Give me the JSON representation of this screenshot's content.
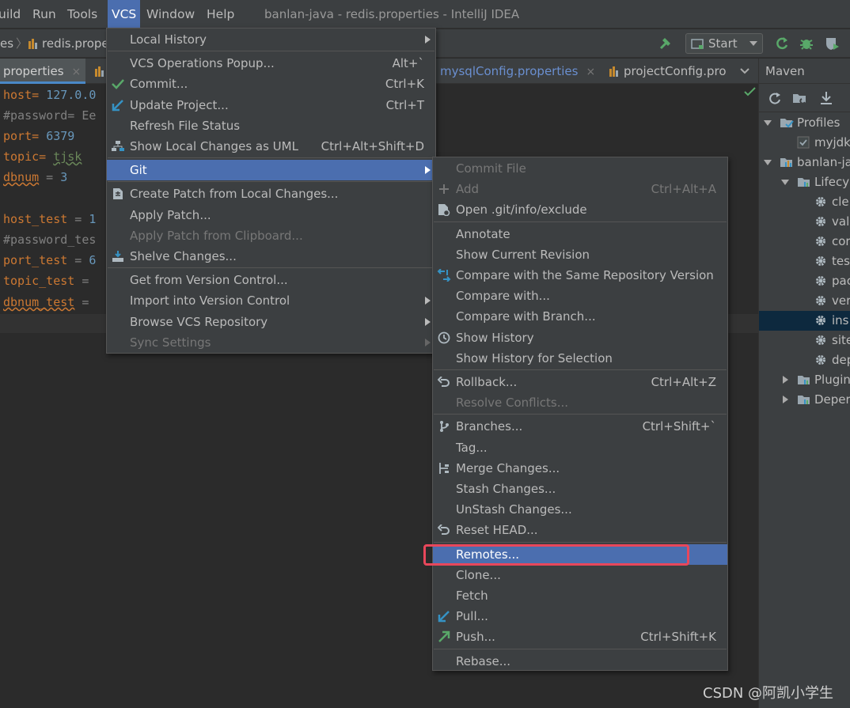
{
  "window": {
    "title": "banlan-java - redis.properties - IntelliJ IDEA"
  },
  "menubar": {
    "items": [
      {
        "label": "uild",
        "name": "menu-build",
        "active": false
      },
      {
        "label": "Run",
        "name": "menu-run",
        "active": false
      },
      {
        "label": "Tools",
        "name": "menu-tools",
        "active": false
      },
      {
        "label": "VCS",
        "name": "menu-vcs",
        "active": true
      },
      {
        "label": "Window",
        "name": "menu-window",
        "active": false
      },
      {
        "label": "Help",
        "name": "menu-help",
        "active": false
      }
    ]
  },
  "navbar": {
    "crumb_prev": "es",
    "crumb_file": "redis.prope",
    "run_config": "Start"
  },
  "tabs": [
    {
      "label": "properties",
      "close": "×"
    },
    {
      "label": "mysqlConfig.properties",
      "close": "×"
    },
    {
      "label": "projectConfig.pro",
      "close": ""
    }
  ],
  "editor": {
    "lines": [
      {
        "key": "host",
        "sep": "= ",
        "value": "127.0.0",
        "kind": "num"
      },
      {
        "key": "#password= Ee",
        "sep": "",
        "value": "",
        "kind": "comment"
      },
      {
        "key": "port",
        "sep": "= ",
        "value": "6379",
        "kind": "num"
      },
      {
        "key": "topic",
        "sep": "= ",
        "value": "tjsk",
        "kind": "str"
      },
      {
        "key": "dbnum",
        "sep": " = ",
        "value": "3",
        "kind": "num"
      },
      {
        "key": "",
        "sep": "",
        "value": "",
        "kind": "blank"
      },
      {
        "key": "host_test",
        "sep": " = ",
        "value": "1",
        "kind": "num"
      },
      {
        "key": "#password_tes",
        "sep": "",
        "value": "",
        "kind": "comment"
      },
      {
        "key": "port_test",
        "sep": " = ",
        "value": "6",
        "kind": "num"
      },
      {
        "key": "topic_test",
        "sep": " =",
        "value": "",
        "kind": "num"
      },
      {
        "key": "dbnum_test",
        "sep": " =",
        "value": "",
        "kind": "num"
      }
    ]
  },
  "maven": {
    "title": "Maven",
    "tree": [
      {
        "label": "Profiles",
        "icon": "profiles-icon",
        "expander": "down",
        "level": 0
      },
      {
        "label": "myjdk",
        "icon": "checkbox-icon",
        "expander": "",
        "level": 1
      },
      {
        "label": "banlan-ja",
        "icon": "maven-project-icon",
        "expander": "down",
        "level": 0
      },
      {
        "label": "Lifecyc",
        "icon": "folder-icon",
        "expander": "down",
        "level": 1
      },
      {
        "label": "cle",
        "icon": "gear-icon",
        "expander": "",
        "level": 2
      },
      {
        "label": "val",
        "icon": "gear-icon",
        "expander": "",
        "level": 2
      },
      {
        "label": "cor",
        "icon": "gear-icon",
        "expander": "",
        "level": 2
      },
      {
        "label": "tes",
        "icon": "gear-icon",
        "expander": "",
        "level": 2
      },
      {
        "label": "pac",
        "icon": "gear-icon",
        "expander": "",
        "level": 2
      },
      {
        "label": "ver",
        "icon": "gear-icon",
        "expander": "",
        "level": 2
      },
      {
        "label": "ins",
        "icon": "gear-icon",
        "expander": "",
        "level": 2,
        "selected": true
      },
      {
        "label": "site",
        "icon": "gear-icon",
        "expander": "",
        "level": 2
      },
      {
        "label": "dep",
        "icon": "gear-icon",
        "expander": "",
        "level": 2
      },
      {
        "label": "Plugin",
        "icon": "folder-icon",
        "expander": "right",
        "level": 1
      },
      {
        "label": "Deper",
        "icon": "folder-icon",
        "expander": "right",
        "level": 1
      }
    ]
  },
  "vcs_menu": {
    "items": [
      {
        "label": "Local History",
        "shortcut": "",
        "submenu": true,
        "icon": "",
        "state": "normal",
        "sep_after": true
      },
      {
        "label": "VCS Operations Popup...",
        "shortcut": "Alt+`",
        "submenu": false,
        "icon": "",
        "state": "normal"
      },
      {
        "label": "Commit...",
        "shortcut": "Ctrl+K",
        "submenu": false,
        "icon": "check-icon",
        "state": "normal"
      },
      {
        "label": "Update Project...",
        "shortcut": "Ctrl+T",
        "submenu": false,
        "icon": "update-arrow-icon",
        "state": "normal"
      },
      {
        "label": "Refresh File Status",
        "shortcut": "",
        "submenu": false,
        "icon": "",
        "state": "normal"
      },
      {
        "label": "Show Local Changes as UML",
        "shortcut": "Ctrl+Alt+Shift+D",
        "submenu": false,
        "icon": "uml-icon",
        "state": "normal",
        "sep_after": true
      },
      {
        "label": "Git",
        "shortcut": "",
        "submenu": true,
        "icon": "",
        "state": "selected",
        "sep_after": true
      },
      {
        "label": "Create Patch from Local Changes...",
        "shortcut": "",
        "submenu": false,
        "icon": "patch-icon",
        "state": "normal"
      },
      {
        "label": "Apply Patch...",
        "shortcut": "",
        "submenu": false,
        "icon": "",
        "state": "normal"
      },
      {
        "label": "Apply Patch from Clipboard...",
        "shortcut": "",
        "submenu": false,
        "icon": "",
        "state": "disabled"
      },
      {
        "label": "Shelve Changes...",
        "shortcut": "",
        "submenu": false,
        "icon": "shelve-icon",
        "state": "normal",
        "sep_after": true
      },
      {
        "label": "Get from Version Control...",
        "shortcut": "",
        "submenu": false,
        "icon": "",
        "state": "normal"
      },
      {
        "label": "Import into Version Control",
        "shortcut": "",
        "submenu": true,
        "icon": "",
        "state": "normal"
      },
      {
        "label": "Browse VCS Repository",
        "shortcut": "",
        "submenu": true,
        "icon": "",
        "state": "normal"
      },
      {
        "label": "Sync Settings",
        "shortcut": "",
        "submenu": true,
        "icon": "",
        "state": "disabled"
      }
    ]
  },
  "git_menu": {
    "items": [
      {
        "label": "Commit File",
        "shortcut": "",
        "icon": "",
        "state": "disabled"
      },
      {
        "label": "Add",
        "shortcut": "Ctrl+Alt+A",
        "icon": "plus-icon",
        "state": "disabled"
      },
      {
        "label": "Open .git/info/exclude",
        "shortcut": "",
        "icon": "settings-file-icon",
        "state": "normal",
        "sep_after": true
      },
      {
        "label": "Annotate",
        "shortcut": "",
        "icon": "",
        "state": "normal"
      },
      {
        "label": "Show Current Revision",
        "shortcut": "",
        "icon": "",
        "state": "normal"
      },
      {
        "label": "Compare with the Same Repository Version",
        "shortcut": "",
        "icon": "diff-arrows-icon",
        "state": "normal"
      },
      {
        "label": "Compare with...",
        "shortcut": "",
        "icon": "",
        "state": "normal"
      },
      {
        "label": "Compare with Branch...",
        "shortcut": "",
        "icon": "",
        "state": "normal"
      },
      {
        "label": "Show History",
        "shortcut": "",
        "icon": "clock-icon",
        "state": "normal"
      },
      {
        "label": "Show History for Selection",
        "shortcut": "",
        "icon": "",
        "state": "normal",
        "sep_after": true
      },
      {
        "label": "Rollback...",
        "shortcut": "Ctrl+Alt+Z",
        "icon": "rollback-icon",
        "state": "normal"
      },
      {
        "label": "Resolve Conflicts...",
        "shortcut": "",
        "icon": "",
        "state": "disabled",
        "sep_after": true
      },
      {
        "label": "Branches...",
        "shortcut": "Ctrl+Shift+`",
        "icon": "branch-icon",
        "state": "normal"
      },
      {
        "label": "Tag...",
        "shortcut": "",
        "icon": "",
        "state": "normal"
      },
      {
        "label": "Merge Changes...",
        "shortcut": "",
        "icon": "merge-icon",
        "state": "normal"
      },
      {
        "label": "Stash Changes...",
        "shortcut": "",
        "icon": "",
        "state": "normal"
      },
      {
        "label": "UnStash Changes...",
        "shortcut": "",
        "icon": "",
        "state": "normal"
      },
      {
        "label": "Reset HEAD...",
        "shortcut": "",
        "icon": "reset-icon",
        "state": "normal",
        "sep_after": true
      },
      {
        "label": "Remotes...",
        "shortcut": "",
        "icon": "",
        "state": "selected"
      },
      {
        "label": "Clone...",
        "shortcut": "",
        "icon": "",
        "state": "normal"
      },
      {
        "label": "Fetch",
        "shortcut": "",
        "icon": "",
        "state": "normal"
      },
      {
        "label": "Pull...",
        "shortcut": "",
        "icon": "pull-arrow-icon",
        "state": "normal"
      },
      {
        "label": "Push...",
        "shortcut": "Ctrl+Shift+K",
        "icon": "push-arrow-icon",
        "state": "normal",
        "sep_after": true
      },
      {
        "label": "Rebase...",
        "shortcut": "",
        "icon": "",
        "state": "normal"
      }
    ]
  },
  "colors": {
    "accent_selection": "#4b6eaf",
    "highlight_box": "#e8475b",
    "check_green": "#59a869",
    "blue_arrow": "#3592c4"
  },
  "watermark": "CSDN @阿凯小学生"
}
